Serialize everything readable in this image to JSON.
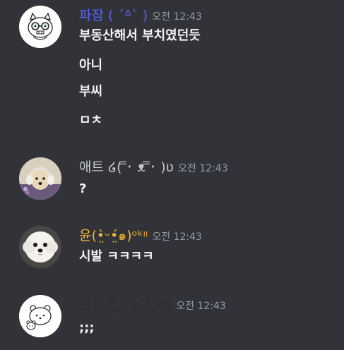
{
  "messages": [
    {
      "username": "파잠 ( ´ᐞ` )",
      "username_color": "#5865f2",
      "timestamp": "오전 12:43",
      "avatar_icon": "glasses-cat-avatar",
      "lines": [
        "부동산해서 부치였던듯",
        "아니",
        "부씨",
        "ㅁㅊ"
      ]
    },
    {
      "username": "애트 ໒( ̿･ ᴥ ̿･ )ʋ",
      "username_color": "#c4c7cc",
      "timestamp": "오전 12:43",
      "avatar_icon": "puppy-with-headphones-avatar",
      "lines": [
        "?"
      ]
    },
    {
      "username": "윤(•̤̀ᵕ•̤́๑)ᵒᵏᵎᵎ",
      "username_color": "#f0b232",
      "timestamp": "오전 12:43",
      "avatar_icon": "white-puppy-avatar",
      "lines": [
        "시발 ㅋㅋㅋㅋ"
      ]
    },
    {
      "username": "반찬 ʕ ̳•̀ ᴥ •́ ̳ʔค",
      "username_color": "#2b2d31",
      "timestamp": "오전 12:43",
      "avatar_icon": "bear-doodle-avatar",
      "lines": [
        ";;;"
      ]
    }
  ]
}
